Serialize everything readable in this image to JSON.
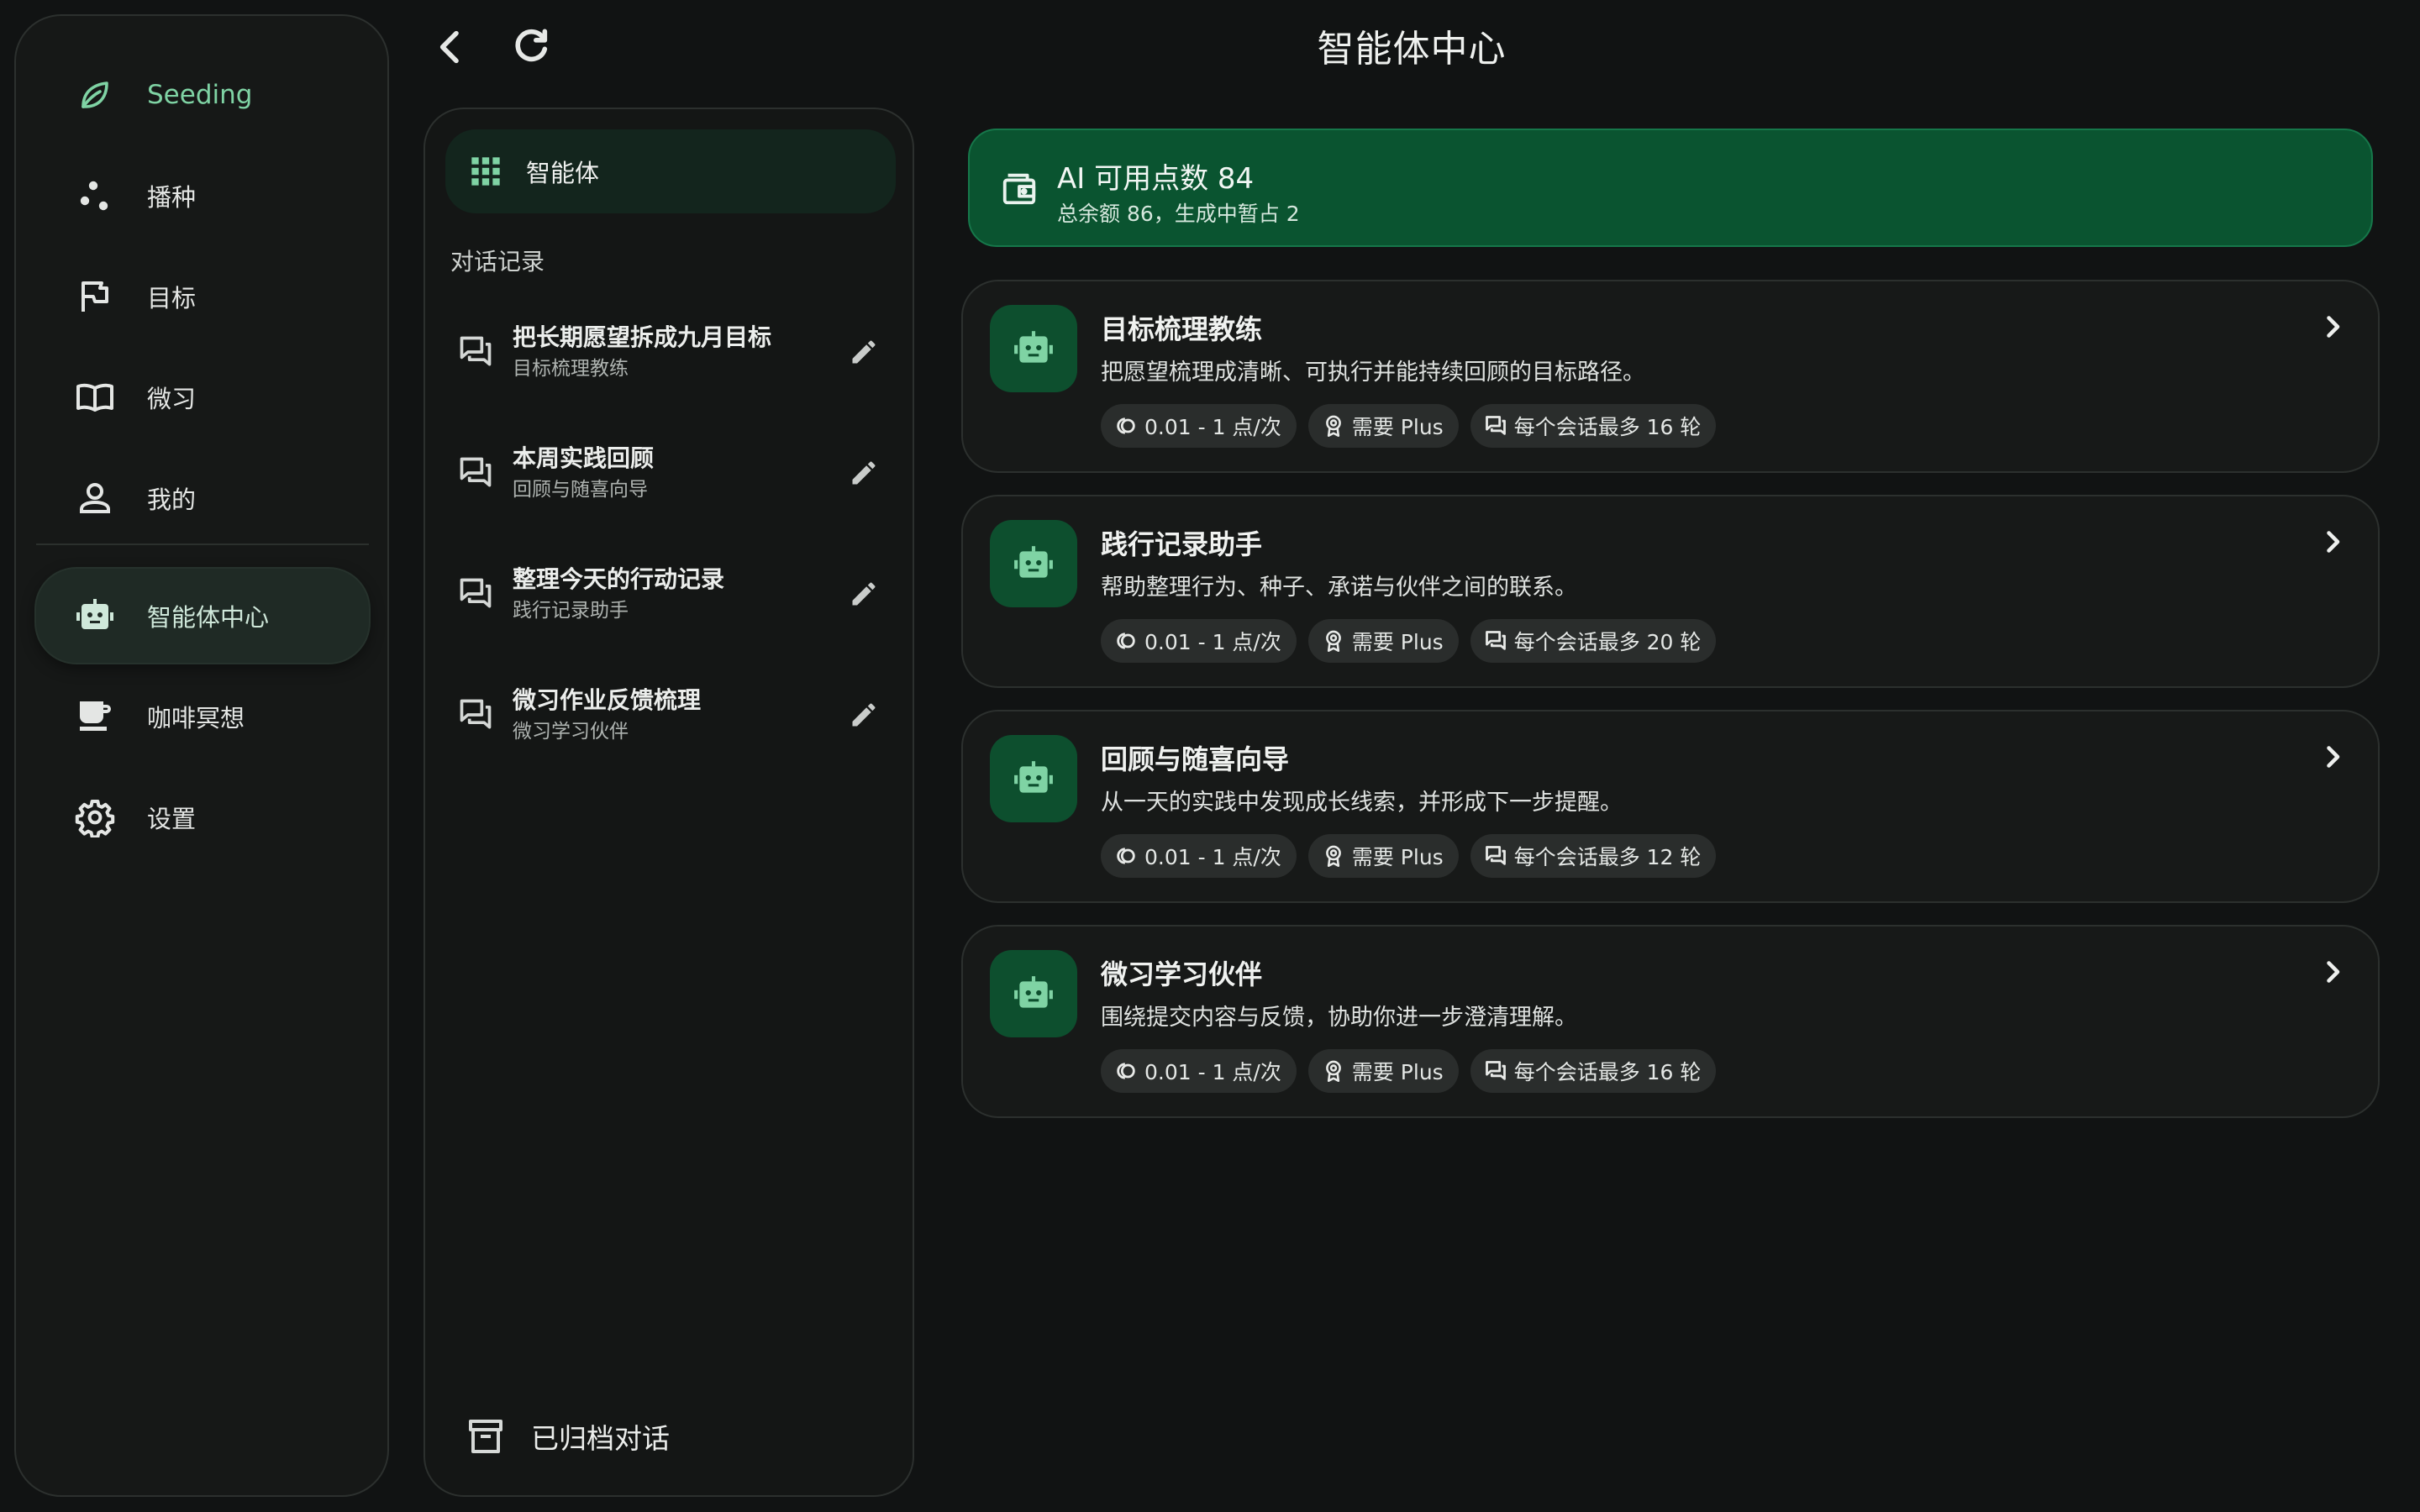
{
  "nav": {
    "items": [
      {
        "label": "Seeding",
        "icon": "leaf-icon"
      },
      {
        "label": "播种",
        "icon": "seeds-icon"
      },
      {
        "label": "目标",
        "icon": "flag-icon"
      },
      {
        "label": "微习",
        "icon": "book-icon"
      },
      {
        "label": "我的",
        "icon": "person-icon"
      },
      {
        "label": "智能体中心",
        "icon": "robot-icon"
      },
      {
        "label": "咖啡冥想",
        "icon": "coffee-icon"
      },
      {
        "label": "设置",
        "icon": "gear-icon"
      }
    ],
    "active_index": 5
  },
  "header": {
    "title": "智能体中心"
  },
  "middle": {
    "agents_tab_label": "智能体",
    "section_title": "对话记录",
    "conversations": [
      {
        "title": "把长期愿望拆成九月目标",
        "agent": "目标梳理教练"
      },
      {
        "title": "本周实践回顾",
        "agent": "回顾与随喜向导"
      },
      {
        "title": "整理今天的行动记录",
        "agent": "践行记录助手"
      },
      {
        "title": "微习作业反馈梳理",
        "agent": "微习学习伙伴"
      }
    ],
    "archive_label": "已归档对话"
  },
  "points": {
    "title": "AI 可用点数 84",
    "subtitle": "总余额 86，生成中暂占 2"
  },
  "agents": [
    {
      "name": "目标梳理教练",
      "description": "把愿望梳理成清晰、可执行并能持续回顾的目标路径。",
      "cost": "0.01 - 1 点/次",
      "requirement": "需要 Plus",
      "limit": "每个会话最多 16 轮"
    },
    {
      "name": "践行记录助手",
      "description": "帮助整理行为、种子、承诺与伙伴之间的联系。",
      "cost": "0.01 - 1 点/次",
      "requirement": "需要 Plus",
      "limit": "每个会话最多 20 轮"
    },
    {
      "name": "回顾与随喜向导",
      "description": "从一天的实践中发现成长线索，并形成下一步提醒。",
      "cost": "0.01 - 1 点/次",
      "requirement": "需要 Plus",
      "limit": "每个会话最多 12 轮"
    },
    {
      "name": "微习学习伙伴",
      "description": "围绕提交内容与反馈，协助你进一步澄清理解。",
      "cost": "0.01 - 1 点/次",
      "requirement": "需要 Plus",
      "limit": "每个会话最多 16 轮"
    }
  ],
  "colors": {
    "background": "#111313",
    "accent": "#7fd3a4",
    "points_banner": "#0a5430",
    "agent_avatar": "#0d4f2e"
  }
}
